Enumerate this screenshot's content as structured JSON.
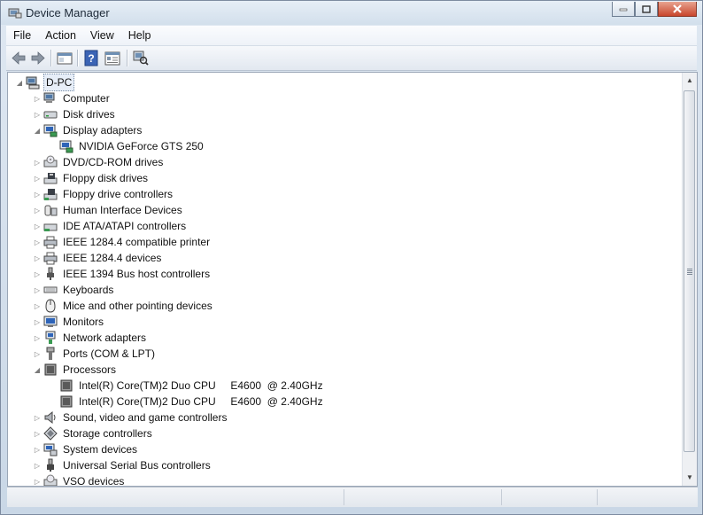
{
  "window": {
    "title": "Device Manager",
    "icon": "device-manager-icon",
    "minimize_label": "—",
    "maximize_label": "□",
    "close_label": "X"
  },
  "menu": [
    "File",
    "Action",
    "View",
    "Help"
  ],
  "toolbar": {
    "buttons": [
      "back-arrow-icon",
      "forward-arrow-icon",
      "show-hide-console-tree-icon",
      "help-icon",
      "properties-icon",
      "scan-hardware-icon"
    ]
  },
  "tree": {
    "root": {
      "label": "D-PC",
      "icon": "computer-root-icon",
      "expanded": true
    },
    "rows": [
      {
        "label": "Computer",
        "level": 1,
        "expanded": false,
        "icon": "computer-icon"
      },
      {
        "label": "Disk drives",
        "level": 1,
        "expanded": false,
        "icon": "disk-drive-icon"
      },
      {
        "label": "Display adapters",
        "level": 1,
        "expanded": true,
        "icon": "display-adapter-icon"
      },
      {
        "label": "NVIDIA GeForce GTS 250",
        "level": 2,
        "icon": "display-adapter-icon"
      },
      {
        "label": "DVD/CD-ROM drives",
        "level": 1,
        "expanded": false,
        "icon": "dvd-drive-icon"
      },
      {
        "label": "Floppy disk drives",
        "level": 1,
        "expanded": false,
        "icon": "floppy-disk-icon"
      },
      {
        "label": "Floppy drive controllers",
        "level": 1,
        "expanded": false,
        "icon": "floppy-controller-icon"
      },
      {
        "label": "Human Interface Devices",
        "level": 1,
        "expanded": false,
        "icon": "hid-icon"
      },
      {
        "label": "IDE ATA/ATAPI controllers",
        "level": 1,
        "expanded": false,
        "icon": "ide-controller-icon"
      },
      {
        "label": "IEEE 1284.4 compatible printer",
        "level": 1,
        "expanded": false,
        "icon": "printer-icon"
      },
      {
        "label": "IEEE 1284.4 devices",
        "level": 1,
        "expanded": false,
        "icon": "printer-icon"
      },
      {
        "label": "IEEE 1394 Bus host controllers",
        "level": 1,
        "expanded": false,
        "icon": "firewire-icon"
      },
      {
        "label": "Keyboards",
        "level": 1,
        "expanded": false,
        "icon": "keyboard-icon"
      },
      {
        "label": "Mice and other pointing devices",
        "level": 1,
        "expanded": false,
        "icon": "mouse-icon"
      },
      {
        "label": "Monitors",
        "level": 1,
        "expanded": false,
        "icon": "monitor-icon"
      },
      {
        "label": "Network adapters",
        "level": 1,
        "expanded": false,
        "icon": "network-adapter-icon"
      },
      {
        "label": "Ports (COM & LPT)",
        "level": 1,
        "expanded": false,
        "icon": "port-icon"
      },
      {
        "label": "Processors",
        "level": 1,
        "expanded": true,
        "icon": "processor-icon"
      },
      {
        "label": "Intel(R) Core(TM)2 Duo CPU     E4600  @ 2.40GHz",
        "level": 2,
        "icon": "processor-icon"
      },
      {
        "label": "Intel(R) Core(TM)2 Duo CPU     E4600  @ 2.40GHz",
        "level": 2,
        "icon": "processor-icon"
      },
      {
        "label": "Sound, video and game controllers",
        "level": 1,
        "expanded": false,
        "icon": "speaker-icon"
      },
      {
        "label": "Storage controllers",
        "level": 1,
        "expanded": false,
        "icon": "storage-controller-icon"
      },
      {
        "label": "System devices",
        "level": 1,
        "expanded": false,
        "icon": "system-device-icon"
      },
      {
        "label": "Universal Serial Bus controllers",
        "level": 1,
        "expanded": false,
        "icon": "usb-icon"
      },
      {
        "label": "VSO devices",
        "level": 1,
        "expanded": false,
        "icon": "vso-device-icon"
      }
    ]
  },
  "colors": {
    "selection": "#e7eef8",
    "chrome": "#dfe8f2"
  }
}
